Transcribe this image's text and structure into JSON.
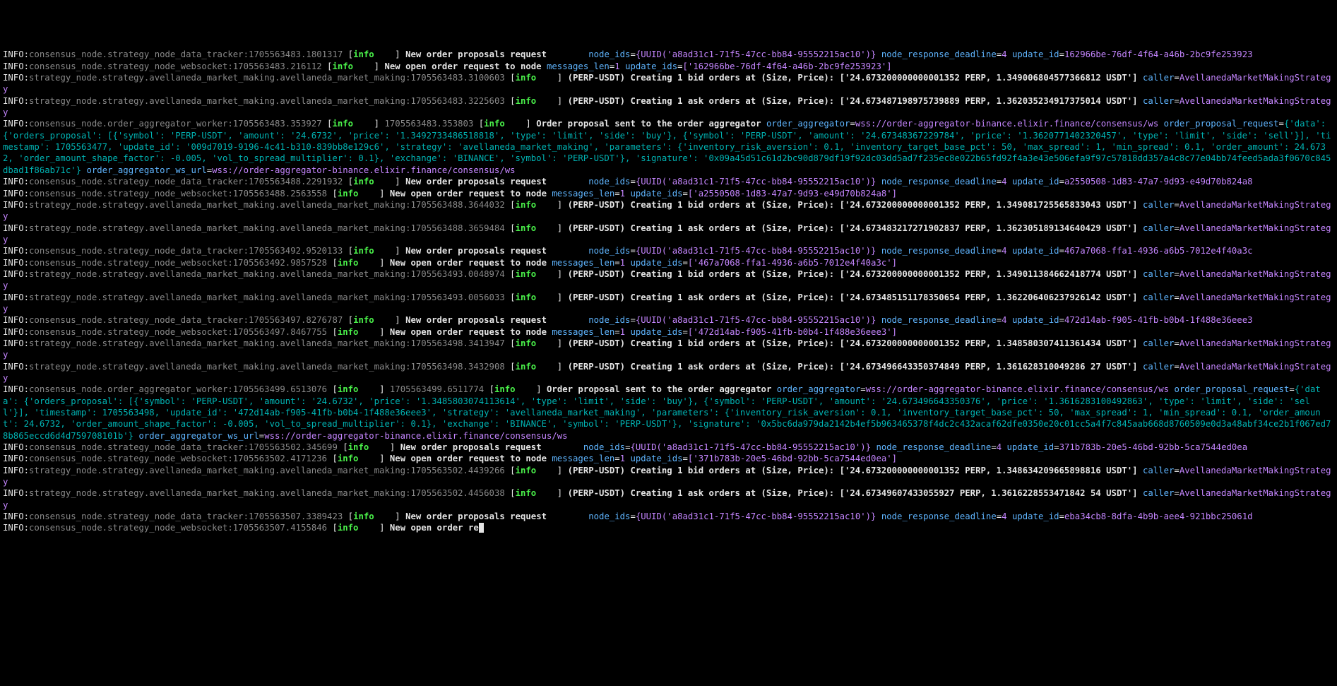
{
  "node_uuid": "a8ad31c1-71f5-47cc-bb84-95552215ac10",
  "deadline": "4",
  "caller": "AvellanedaMarketMakingStrategy",
  "agg_url": "wss://order-aggregator-binance.elixir.finance/consensus/ws",
  "lines": [
    {
      "t": "tracker",
      "ts": "1705563483.1801317",
      "uid": "162966be-76df-4f64-a46b-2bc9fe253923"
    },
    {
      "t": "ws",
      "ts": "1705563483.216112",
      "mlen": "1",
      "uids": "['162966be-76df-4f64-a46b-2bc9fe253923']"
    },
    {
      "t": "mm",
      "ts": "1705563483.3100603",
      "side": "bid",
      "sp": "['24.673200000000001352 PERP, 1.349006804577366812 USDT']"
    },
    {
      "t": "mm",
      "ts": "1705563483.3225603",
      "side": "ask",
      "sp": "['24.673487198975739889 PERP, 1.362035234917375014 USDT']"
    },
    {
      "t": "agg",
      "ts": "1705563483.353927",
      "ts2": "1705563483.353803",
      "body": "{'data': {'orders_proposal': [{'symbol': 'PERP-USDT', 'amount': '24.6732', 'price': '1.3492733486518818', 'type': 'limit', 'side': 'buy'}, {'symbol': 'PERP-USDT', 'amount': '24.67348367229784', 'price': '1.3620771402320457', 'type': 'limit', 'side': 'sell'}], 'timestamp': 1705563477, 'update_id': '009d7019-9196-4c41-b310-839bb8e129c6', 'strategy': 'avellaneda_market_making', 'parameters': {'inventory_risk_aversion': 0.1, 'inventory_target_base_pct': 50, 'max_spread': 1, 'min_spread': 0.1, 'order_amount': 24.6732, 'order_amount_shape_factor': -0.005, 'vol_to_spread_multiplier': 0.1}, 'exchange': 'BINANCE', 'symbol': 'PERP-USDT'}, 'signature': '0x09a45d51c61d2bc90d879df19f92dc03dd5ad7f235ec8e022b65fd92f4a3e43e506efa9f97c57818dd357a4c8c77e04bb74feed5ada3f0670c845dbad1f86ab71c'}"
    },
    {
      "t": "tracker",
      "ts": "1705563488.2291932",
      "uid": "a2550508-1d83-47a7-9d93-e49d70b824a8"
    },
    {
      "t": "ws",
      "ts": "1705563488.2563558",
      "mlen": "1",
      "uids": "['a2550508-1d83-47a7-9d93-e49d70b824a8']"
    },
    {
      "t": "mm",
      "ts": "1705563488.3644032",
      "side": "bid",
      "sp": "['24.673200000000001352 PERP, 1.349081725565833043 USDT']"
    },
    {
      "t": "mm",
      "ts": "1705563488.3659484",
      "side": "ask",
      "sp": "['24.673483217271902837 PERP, 1.362305189134640429 USDT']"
    },
    {
      "t": "tracker",
      "ts": "1705563492.9520133",
      "uid": "467a7068-ffa1-4936-a6b5-7012e4f40a3c"
    },
    {
      "t": "ws",
      "ts": "1705563492.9857528",
      "mlen": "1",
      "uids": "['467a7068-ffa1-4936-a6b5-7012e4f40a3c']"
    },
    {
      "t": "mm",
      "ts": "1705563493.0048974",
      "side": "bid",
      "sp": "['24.673200000000001352 PERP, 1.349011384662418774 USDT']"
    },
    {
      "t": "mm",
      "ts": "1705563493.0056033",
      "side": "ask",
      "sp": "['24.673485151178350654 PERP, 1.362206406237926142 USDT']"
    },
    {
      "t": "tracker",
      "ts": "1705563497.8276787",
      "uid": "472d14ab-f905-41fb-b0b4-1f488e36eee3"
    },
    {
      "t": "ws",
      "ts": "1705563497.8467755",
      "mlen": "1",
      "uids": "['472d14ab-f905-41fb-b0b4-1f488e36eee3']"
    },
    {
      "t": "mm",
      "ts": "1705563498.3413947",
      "side": "bid",
      "sp": "['24.673200000000001352 PERP, 1.348580307411361434 USDT']"
    },
    {
      "t": "mm",
      "ts": "1705563498.3432908",
      "side": "ask",
      "sp": "['24.673496643350374849 PERP, 1.361628310049286 27 USDT']"
    },
    {
      "t": "agg",
      "ts": "1705563499.6513076",
      "ts2": "1705563499.6511774",
      "body": "{'data': {'orders_proposal': [{'symbol': 'PERP-USDT', 'amount': '24.6732', 'price': '1.3485803074113614', 'type': 'limit', 'side': 'buy'}, {'symbol': 'PERP-USDT', 'amount': '24.673496643350376', 'price': '1.3616283100492863', 'type': 'limit', 'side': 'sell'}], 'timestamp': 1705563498, 'update_id': '472d14ab-f905-41fb-b0b4-1f488e36eee3', 'strategy': 'avellaneda_market_making', 'parameters': {'inventory_risk_aversion': 0.1, 'inventory_target_base_pct': 50, 'max_spread': 1, 'min_spread': 0.1, 'order_amount': 24.6732, 'order_amount_shape_factor': -0.005, 'vol_to_spread_multiplier': 0.1}, 'exchange': 'BINANCE', 'symbol': 'PERP-USDT'}, 'signature': '0x5bc6da979da2142b4ef5b963465378f4dc2c432acaf62dfe0350e20c01cc5a4f7c845aab668d8760509e0d3a48abf34ce2b1f067ed78b865eccd6d4d759708101b'}"
    },
    {
      "t": "tracker",
      "ts": "1705563502.345699",
      "uid": "371b783b-20e5-46bd-92bb-5ca7544ed0ea"
    },
    {
      "t": "ws",
      "ts": "1705563502.4171236",
      "mlen": "1",
      "uids": "['371b783b-20e5-46bd-92bb-5ca7544ed0ea']"
    },
    {
      "t": "mm",
      "ts": "1705563502.4439266",
      "side": "bid",
      "sp": "['24.673200000000001352 PERP, 1.348634209665898816 USDT']"
    },
    {
      "t": "mm",
      "ts": "1705563502.4456038",
      "side": "ask",
      "sp": "['24.67349607433055927 PERP, 1.3616228553471842 54 USDT']"
    },
    {
      "t": "tracker",
      "ts": "1705563507.3389423",
      "uid": "eba34cb8-8dfa-4b9b-aee4-921bbc25061d"
    },
    {
      "t": "wspartial",
      "ts": "1705563507.4155846"
    }
  ]
}
